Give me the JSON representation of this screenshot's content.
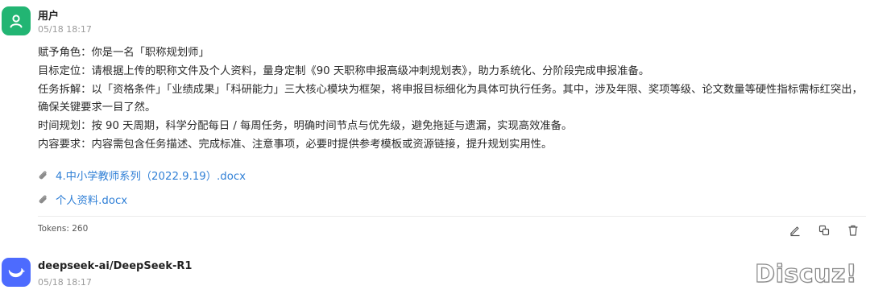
{
  "user_message": {
    "author": "用户",
    "time": "05/18 18:17",
    "lines": [
      "赋予角色：你是一名「职称规划师」",
      "目标定位：请根据上传的职称文件及个人资料，量身定制《90 天职称申报高级冲刺规划表》，助力系统化、分阶段完成申报准备。",
      "任务拆解：以「资格条件」「业绩成果」「科研能力」三大核心模块为框架，将申报目标细化为具体可执行任务。其中，涉及年限、奖项等级、论文数量等硬性指标需标红突出，确保关键要求一目了然。",
      "时间规划：按 90 天周期，科学分配每日 / 每周任务，明确时间节点与优先级，避免拖延与遗漏，实现高效准备。",
      "内容要求：内容需包含任务描述、完成标准、注意事项，必要时提供参考模板或资源链接，提升规划实用性。"
    ],
    "attachments": [
      {
        "name": "4.中小学教师系列（2022.9.19）.docx",
        "icon": "paperclip-icon"
      },
      {
        "name": "个人资料.docx",
        "icon": "paperclip-icon"
      }
    ],
    "tokens_text": "Tokens: 260",
    "actions": [
      {
        "name": "edit",
        "icon": "pencil-icon"
      },
      {
        "name": "copy",
        "icon": "copy-icon"
      },
      {
        "name": "delete",
        "icon": "trash-icon"
      }
    ]
  },
  "assistant_message": {
    "author": "deepseek-ai/DeepSeek-R1",
    "time": "05/18 18:17",
    "avatar_icon": "deepseek-whale-icon"
  },
  "watermark": "Discuz!",
  "colors": {
    "user_avatar": "#22b573",
    "assistant_avatar": "#4d6bfe",
    "link": "#2f7fd6"
  }
}
